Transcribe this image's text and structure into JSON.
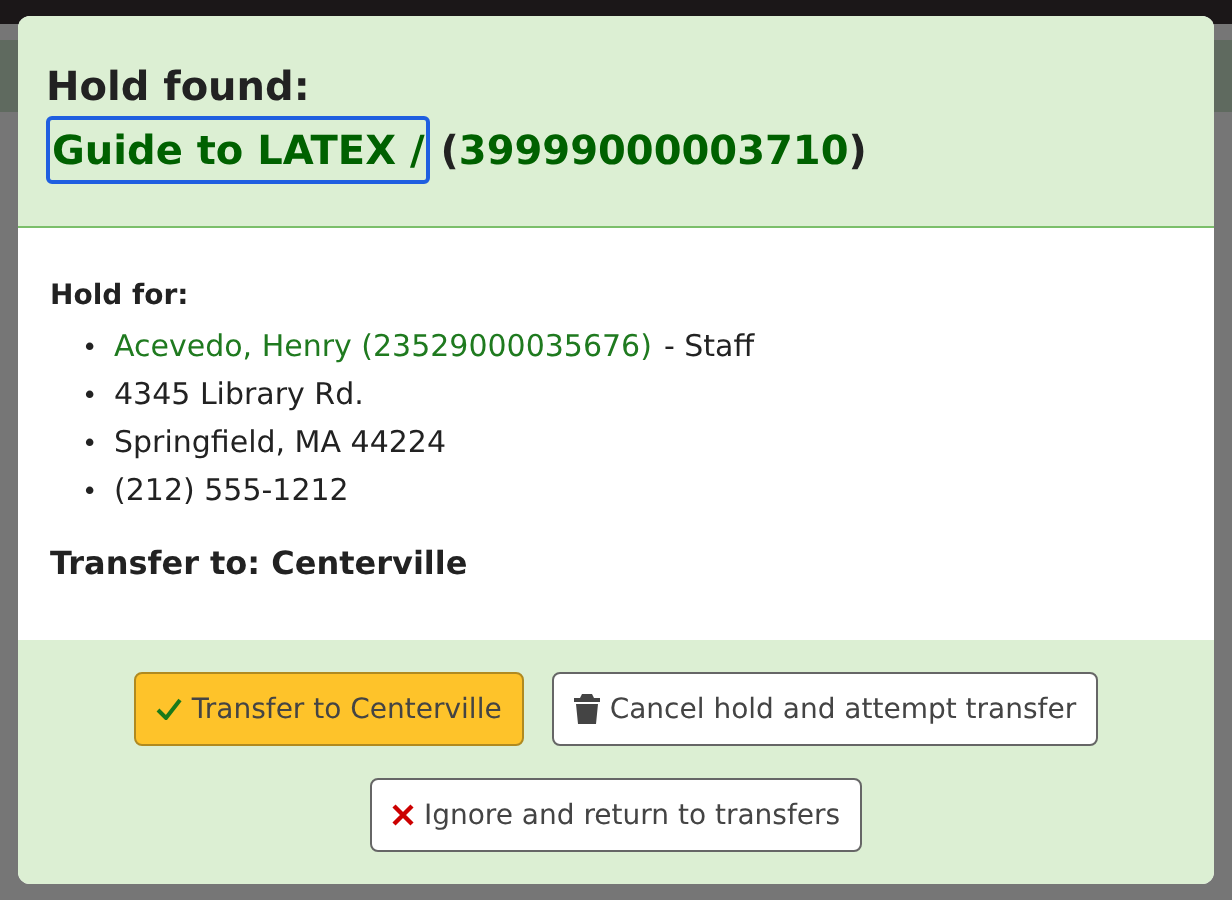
{
  "modal": {
    "title": "Hold found:",
    "item_title": "Guide to LATEX /",
    "barcode_open": "(",
    "barcode": "39999000003710",
    "barcode_close": ")"
  },
  "hold_for": {
    "heading": "Hold for:",
    "bullet": "•",
    "patron": "Acevedo, Henry (23529000035676)",
    "patron_category": "- Staff",
    "lines": [
      "4345 Library Rd.",
      "Springfield, MA 44224",
      "(212) 555-1212"
    ]
  },
  "transfer_to": "Transfer to: Centerville",
  "buttons": [
    {
      "label": "Transfer to Centerville",
      "kind": "primary"
    },
    {
      "label": "Cancel hold and attempt transfer",
      "kind": "default"
    },
    {
      "label": "Ignore and return to transfers",
      "kind": "default"
    }
  ]
}
